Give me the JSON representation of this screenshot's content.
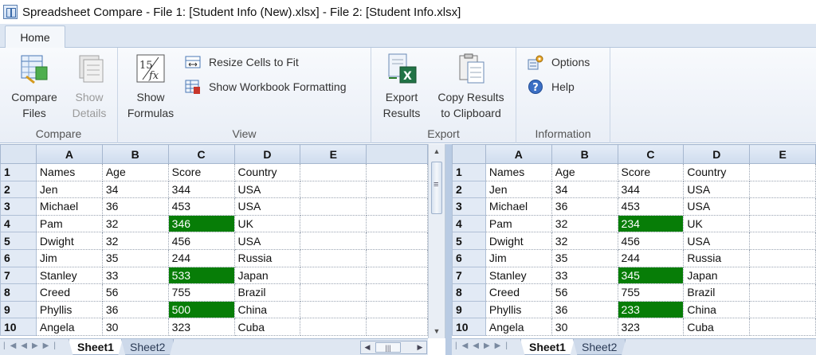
{
  "window": {
    "title": "Spreadsheet Compare - File 1: [Student Info (New).xlsx] - File 2: [Student Info.xlsx]"
  },
  "ribbon": {
    "tab_home": "Home",
    "groups": {
      "compare": {
        "label": "Compare",
        "compare_files": [
          "Compare",
          "Files"
        ],
        "show_details": [
          "Show",
          "Details"
        ]
      },
      "view": {
        "label": "View",
        "show_formulas": [
          "Show",
          "Formulas"
        ],
        "resize_cells": "Resize Cells to Fit",
        "show_workbook_formatting": "Show Workbook Formatting"
      },
      "export": {
        "label": "Export",
        "export_results": [
          "Export",
          "Results"
        ],
        "copy_results": [
          "Copy Results",
          "to Clipboard"
        ]
      },
      "information": {
        "label": "Information",
        "options": "Options",
        "help": "Help"
      }
    }
  },
  "diff_color": "#077d07",
  "columns": [
    "A",
    "B",
    "C",
    "D",
    "E"
  ],
  "left_sheet": {
    "rows": [
      [
        "Names",
        "Age",
        "Score",
        "Country",
        ""
      ],
      [
        "Jen",
        "34",
        "344",
        "USA",
        ""
      ],
      [
        "Michael",
        "36",
        "453",
        "USA",
        ""
      ],
      [
        "Pam",
        "32",
        "346",
        "UK",
        ""
      ],
      [
        "Dwight",
        "32",
        "456",
        "USA",
        ""
      ],
      [
        "Jim",
        "35",
        "244",
        "Russia",
        ""
      ],
      [
        "Stanley",
        "33",
        "533",
        "Japan",
        ""
      ],
      [
        "Creed",
        "56",
        "755",
        "Brazil",
        ""
      ],
      [
        "Phyllis",
        "36",
        "500",
        "China",
        ""
      ],
      [
        "Angela",
        "30",
        "323",
        "Cuba",
        ""
      ]
    ],
    "tabs": [
      "Sheet1",
      "Sheet2"
    ]
  },
  "right_sheet": {
    "rows": [
      [
        "Names",
        "Age",
        "Score",
        "Country",
        ""
      ],
      [
        "Jen",
        "34",
        "344",
        "USA",
        ""
      ],
      [
        "Michael",
        "36",
        "453",
        "USA",
        ""
      ],
      [
        "Pam",
        "32",
        "234",
        "UK",
        ""
      ],
      [
        "Dwight",
        "32",
        "456",
        "USA",
        ""
      ],
      [
        "Jim",
        "35",
        "244",
        "Russia",
        ""
      ],
      [
        "Stanley",
        "33",
        "345",
        "Japan",
        ""
      ],
      [
        "Creed",
        "56",
        "755",
        "Brazil",
        ""
      ],
      [
        "Phyllis",
        "36",
        "233",
        "China",
        ""
      ],
      [
        "Angela",
        "30",
        "323",
        "Cuba",
        ""
      ]
    ],
    "tabs": [
      "Sheet1",
      "Sheet2"
    ]
  },
  "highlighted_cells": [
    {
      "row": 4,
      "col": "C"
    },
    {
      "row": 7,
      "col": "C"
    },
    {
      "row": 9,
      "col": "C"
    }
  ]
}
